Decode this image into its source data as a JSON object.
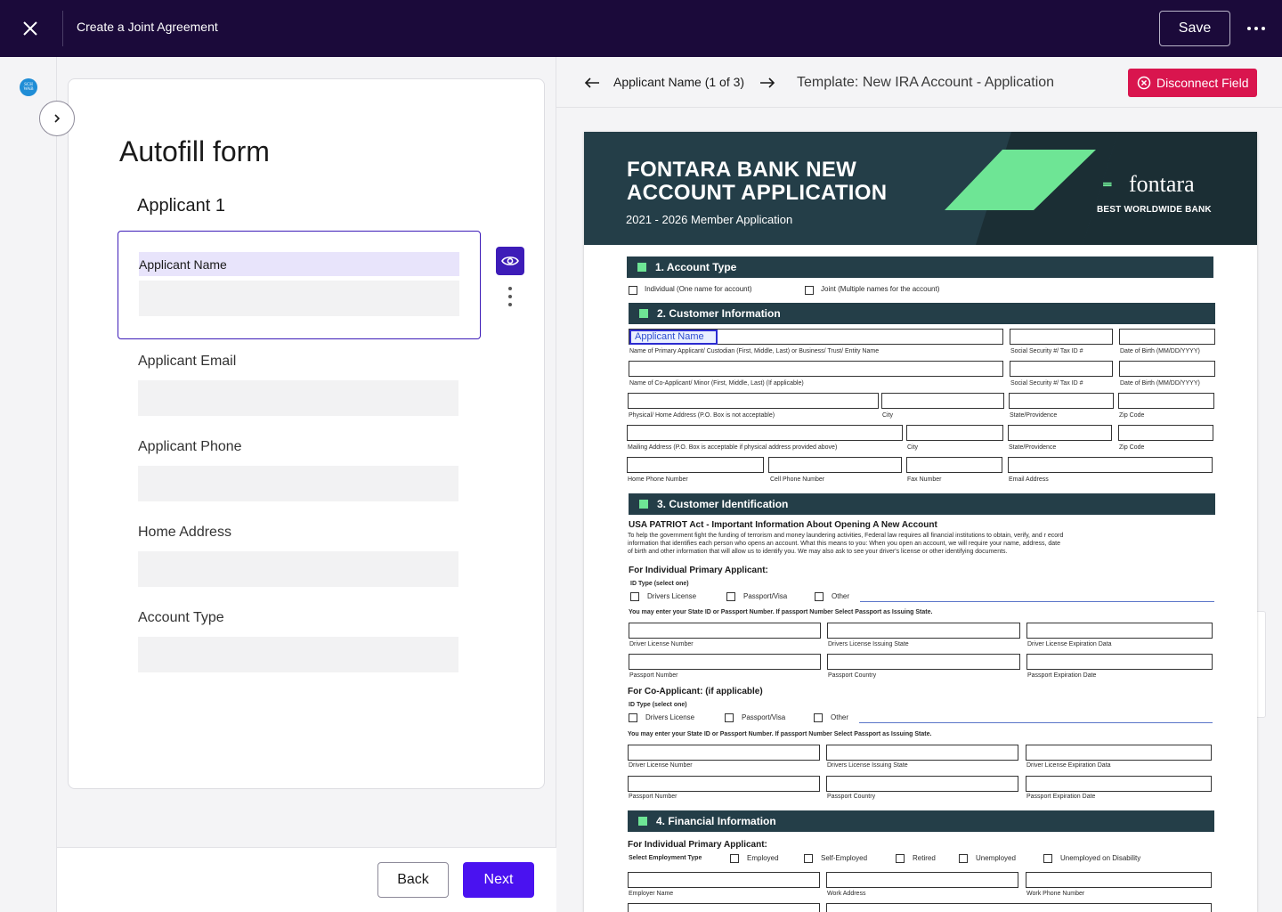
{
  "topbar": {
    "title": "Create a Joint Agreement",
    "save_label": "Save"
  },
  "rail": {
    "logo_text": "SCH WAB"
  },
  "form": {
    "title": "Autofill form",
    "section": "Applicant 1",
    "active_field_label": "Applicant Name",
    "fields": {
      "email": "Applicant Email",
      "phone": "Applicant Phone",
      "address": "Home Address",
      "account_type": "Account Type"
    },
    "back_label": "Back",
    "next_label": "Next"
  },
  "viewer": {
    "nav_label": "Applicant Name (1 of 3)",
    "template_label": "Template: New IRA Account - Application",
    "disconnect_label": "Disconnect Field"
  },
  "doc": {
    "title_line1": "FONTARA BANK NEW",
    "title_line2": "ACCOUNT APPLICATION",
    "subtitle": "2021 - 2026 Member Application",
    "brand": "fontara",
    "brand_tag": "BEST WORLDWIDE BANK",
    "sec1": "1. Account Type",
    "individual": "Individual (One name for account)",
    "joint": "Joint (Multiple names for the account)",
    "sec2": "2. Customer Information",
    "app_name_tag": "Applicant Name",
    "primary_name": "Name of Primary Applicant/ Custodian (First, Middle, Last) or   Business/ Trust/ Entity Name",
    "ssn": "Social Security #/ Tax ID #",
    "dob": "Date of Birth (MM/DD/YYYY)",
    "co_name": "Name of Co-Applicant/ Minor (First, Middle, Last) (If applicable)",
    "phys_addr": "Physical/ Home Address (P.O. Box is not acceptable)",
    "city": "City",
    "state": "State/Providence",
    "zip": "Zip Code",
    "mail_addr": "Mailing Address (P.O. Box is acceptable if physical address provided above)",
    "home_phone": "Home Phone Number",
    "cell_phone": "Cell Phone Number",
    "fax": "Fax Number",
    "email": "Email Address",
    "sec3": "3. Customer Identification",
    "patriot_title": "USA PATRIOT Act - Important Information About Opening A New Account",
    "patriot_l1": "To help the government fight the funding of terrorism and money laundering activities, Federal law requires all financial institutions to obtain, verify, and r ecord",
    "patriot_l2": "information that identifies each person who opens an account.  What this means to you: When you open an account, we will require your name, address, date",
    "patriot_l3": "of birth and other information that will allow us to identify you. We may also ask to see your driver's license or other identifying documents.",
    "for_primary": "For Individual Primary Applicant:",
    "id_type": "ID Type (select one)",
    "drivers_license": "Drivers License",
    "passport_visa": "Passport/Visa",
    "other": "Other",
    "state_id_note": "You may enter your State ID or Passport Number. If passport Number Select Passport as Issuing State.",
    "dl_number": "Driver License Number",
    "dl_state": "Drivers License Issuing State",
    "dl_exp": "Driver License Expiration Data",
    "passport_number": "Passport Number",
    "passport_country": "Passport Country",
    "passport_exp": "Passport Expiration Date",
    "for_co": "For Co-Applicant: (if applicable)",
    "sec4": "4. Financial Information",
    "emp_type": "Select Employment Type",
    "employed": "Employed",
    "self_employed": "Self-Employed",
    "retired": "Retired",
    "unemployed": "Unemployed",
    "unemployed_disability": "Unemployed on Disability",
    "employer_name": "Employer Name",
    "work_address": "Work Address",
    "work_phone": "Work Phone Number"
  },
  "colors": {
    "topbar": "#1b0a3a",
    "accent": "#4a12f0",
    "danger": "#d9154e",
    "doc_header": "#243e48",
    "doc_green": "#6ee595"
  }
}
